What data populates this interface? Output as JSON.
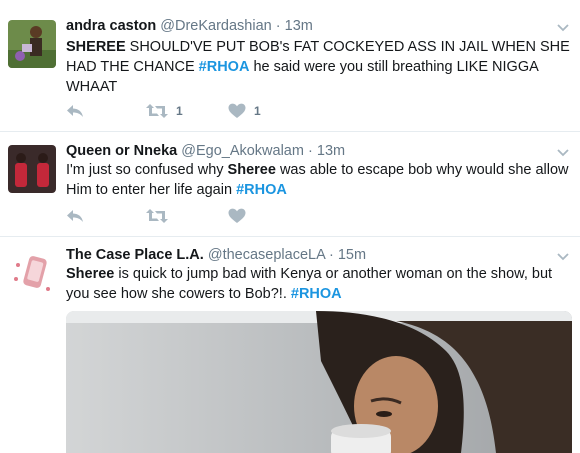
{
  "tweets": [
    {
      "name": "andra caston",
      "handle": "@DreKardashian",
      "time": "13m",
      "text_pre": "",
      "bold": "SHEREE",
      "text_mid": " SHOULD'VE PUT BOB's FAT COCKEYED ASS IN JAIL WHEN SHE HAD THE CHANCE ",
      "hashtag": "#RHOA",
      "text_post": " he said were you still breathing LIKE NIGGA WHAAT",
      "retweets": "1",
      "likes": "1"
    },
    {
      "name": "Queen or Nneka",
      "handle": "@Ego_Akokwalam",
      "time": "13m",
      "text_pre": "I'm just so confused why ",
      "bold": "Sheree",
      "text_mid": " was able to escape bob why would she allow Him to enter her life again ",
      "hashtag": "#RHOA",
      "text_post": "",
      "retweets": "",
      "likes": ""
    },
    {
      "name": "The Case Place L.A.",
      "handle": "@thecaseplaceLA",
      "time": "15m",
      "text_pre": "",
      "bold": "Sheree",
      "text_mid": " is quick to jump bad with Kenya or another woman on the show, but you see how she cowers to Bob?!. ",
      "hashtag": "#RHOA",
      "text_post": "",
      "retweets": "",
      "likes": ""
    }
  ],
  "separator": "·",
  "colors": {
    "accent": "#1b95e0",
    "icon": "#aab8c2",
    "muted": "#657786",
    "divider": "#e6ecf0"
  },
  "icons": [
    "reply-icon",
    "retweet-icon",
    "like-icon",
    "caret-down-icon"
  ]
}
